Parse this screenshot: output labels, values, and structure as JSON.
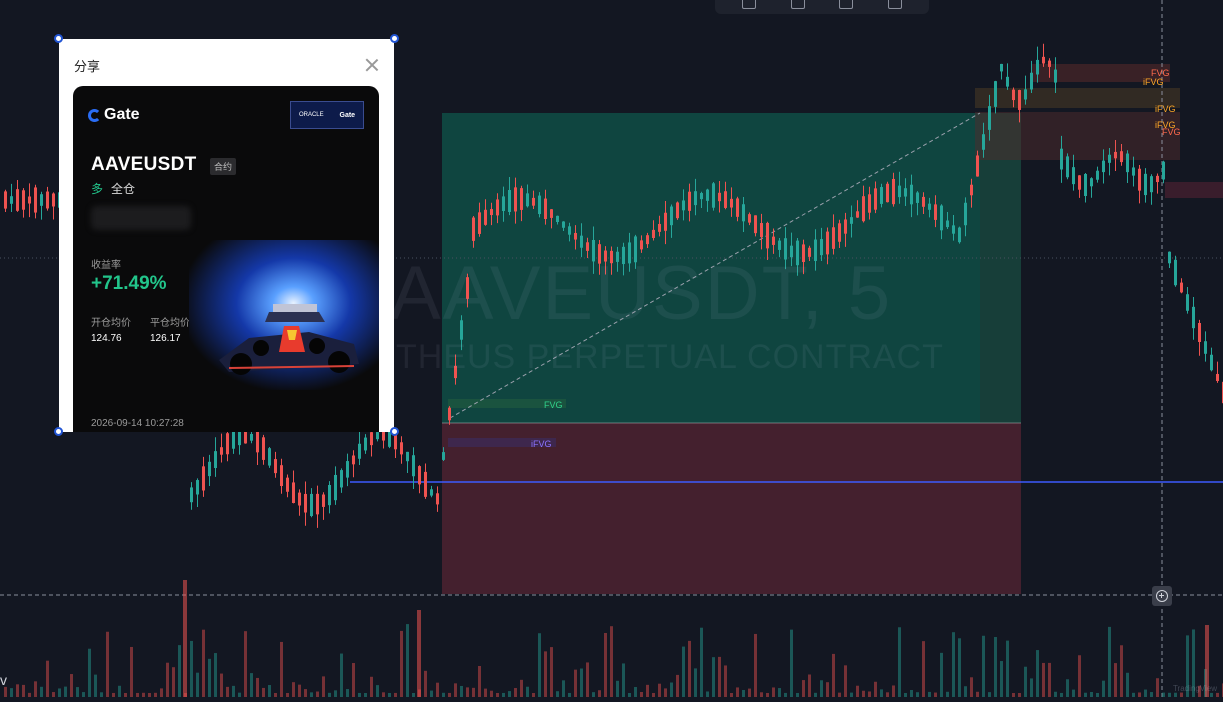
{
  "chart": {
    "watermark_title": "AAVEUSDT, 5",
    "watermark_subtitle": "THEUS PERPETUAL CONTRACT",
    "fvg_labels": {
      "fvg_green": "FVG",
      "ifvg_purple": "iFVG",
      "fvg_right_1": "FVG",
      "ifvg_right_1": "iFVG",
      "ifvg_right_2": "iFVG",
      "ifvg_right_3": "iFVG",
      "fvg_right_2": "FVG"
    },
    "colors": {
      "background": "#131722",
      "bull": "#26a69a",
      "bear": "#ef5350",
      "profit_zone": "#0f4a44",
      "loss_zone": "#4a2130",
      "horizontal_line": "#3d5afe"
    },
    "corner_symbol": "v",
    "credit": "TradingView"
  },
  "toolbar": {
    "icons": [
      "layout-icon",
      "tag-icon",
      "share-icon",
      "trash-icon"
    ]
  },
  "share_dialog": {
    "title": "分享",
    "close_icon": "close-icon",
    "card": {
      "brand": "Gate",
      "sponsor_line1": "ORACLE",
      "sponsor_line2": "Gate",
      "symbol": "AAVEUSDT",
      "contract_tag": "合约",
      "side": "多",
      "margin_mode": "全仓",
      "roi_label": "收益率",
      "roi_value": "+71.49%",
      "open_price_label": "开仓均价",
      "close_price_label": "平仓均价",
      "open_price": "124.76",
      "close_price": "126.17",
      "timestamp": "2026-09-14 10:27:28"
    }
  }
}
